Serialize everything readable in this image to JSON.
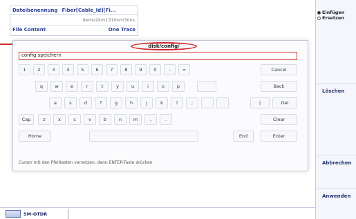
{
  "background_table": {
    "header": [
      "Dateibenennung",
      "Fiber[Cable_Id][Fi..."
    ],
    "row_value": "demo2km1310nm30ns",
    "footer_left": "File Content",
    "footer_right": "One Trace"
  },
  "right_panel": {
    "radio_options": [
      {
        "label": "Einfügen",
        "selected": true
      },
      {
        "label": "Ersetzen",
        "selected": false
      }
    ],
    "buttons": [
      "Löschen",
      "Abbrechen",
      "Anwenden"
    ]
  },
  "dialog": {
    "title": "disk/config/",
    "input_value": "config speichern",
    "cursor_hint": "Cursor mit den Pfeiltasten versetzen, dann ENTER-Taste drücken",
    "rows": [
      [
        "1",
        "2",
        "3",
        "4",
        "5",
        "6",
        "7",
        "8",
        "9",
        "0",
        "-",
        "=",
        "Cancel"
      ],
      [
        "q",
        "w",
        "e",
        "r",
        "t",
        "y",
        "u",
        "i",
        "o",
        "p",
        "",
        "Back"
      ],
      [
        "a",
        "s",
        "d",
        "f",
        "g",
        "h",
        "j",
        "k",
        "l",
        ";",
        "",
        "",
        "|",
        "Del"
      ],
      [
        "Cap",
        "z",
        "x",
        "c",
        "v",
        "b",
        "n",
        "m",
        ",",
        ".",
        "Clear"
      ],
      [
        "Home",
        "",
        "End",
        "Enter"
      ]
    ]
  },
  "bottom_tab": {
    "label": "SM-OTDR"
  }
}
